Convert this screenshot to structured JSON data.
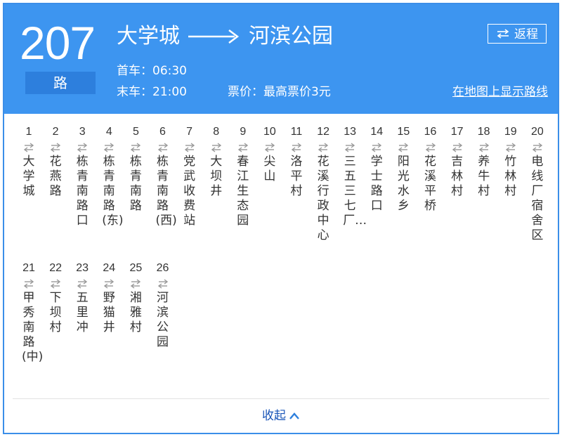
{
  "route": {
    "number": "207",
    "suffix": "路"
  },
  "direction": {
    "from": "大学城",
    "to": "河滨公园"
  },
  "return_button": {
    "icon": "swap-arrows-icon",
    "label": "返程"
  },
  "schedule": {
    "first_bus": "首车：06:30",
    "last_bus": "末车：21:00"
  },
  "fare": "票价：最高票价3元",
  "map_link": "在地图上显示路线",
  "stops": [
    {
      "num": "1",
      "name": "大学城"
    },
    {
      "num": "2",
      "name": "花燕路"
    },
    {
      "num": "3",
      "name": "栋青南路口"
    },
    {
      "num": "4",
      "name": "栋青南路(东)"
    },
    {
      "num": "5",
      "name": "栋青南路"
    },
    {
      "num": "6",
      "name": "栋青南路(西)"
    },
    {
      "num": "7",
      "name": "党武收费站"
    },
    {
      "num": "8",
      "name": "大坝井"
    },
    {
      "num": "9",
      "name": "春江生态园"
    },
    {
      "num": "10",
      "name": "尖山"
    },
    {
      "num": "11",
      "name": "洛平村"
    },
    {
      "num": "12",
      "name": "花溪行政中心"
    },
    {
      "num": "13",
      "name": "三五三七厂…"
    },
    {
      "num": "14",
      "name": "学士路口"
    },
    {
      "num": "15",
      "name": "阳光水乡"
    },
    {
      "num": "16",
      "name": "花溪平桥"
    },
    {
      "num": "17",
      "name": "吉林村"
    },
    {
      "num": "18",
      "name": "养牛村"
    },
    {
      "num": "19",
      "name": "竹林村"
    },
    {
      "num": "20",
      "name": "电线厂宿舍区"
    },
    {
      "num": "21",
      "name": "甲秀南路(中)"
    },
    {
      "num": "22",
      "name": "下坝村"
    },
    {
      "num": "23",
      "name": "五里冲"
    },
    {
      "num": "24",
      "name": "野猫井"
    },
    {
      "num": "25",
      "name": "湘雅村"
    },
    {
      "num": "26",
      "name": "河滨公园"
    }
  ],
  "collapse": {
    "label": "收起",
    "icon": "chevron-up-icon"
  },
  "colors": {
    "header": "#3d95f0",
    "accent_dark": "#2d7fdd",
    "link": "#1a55b8"
  }
}
